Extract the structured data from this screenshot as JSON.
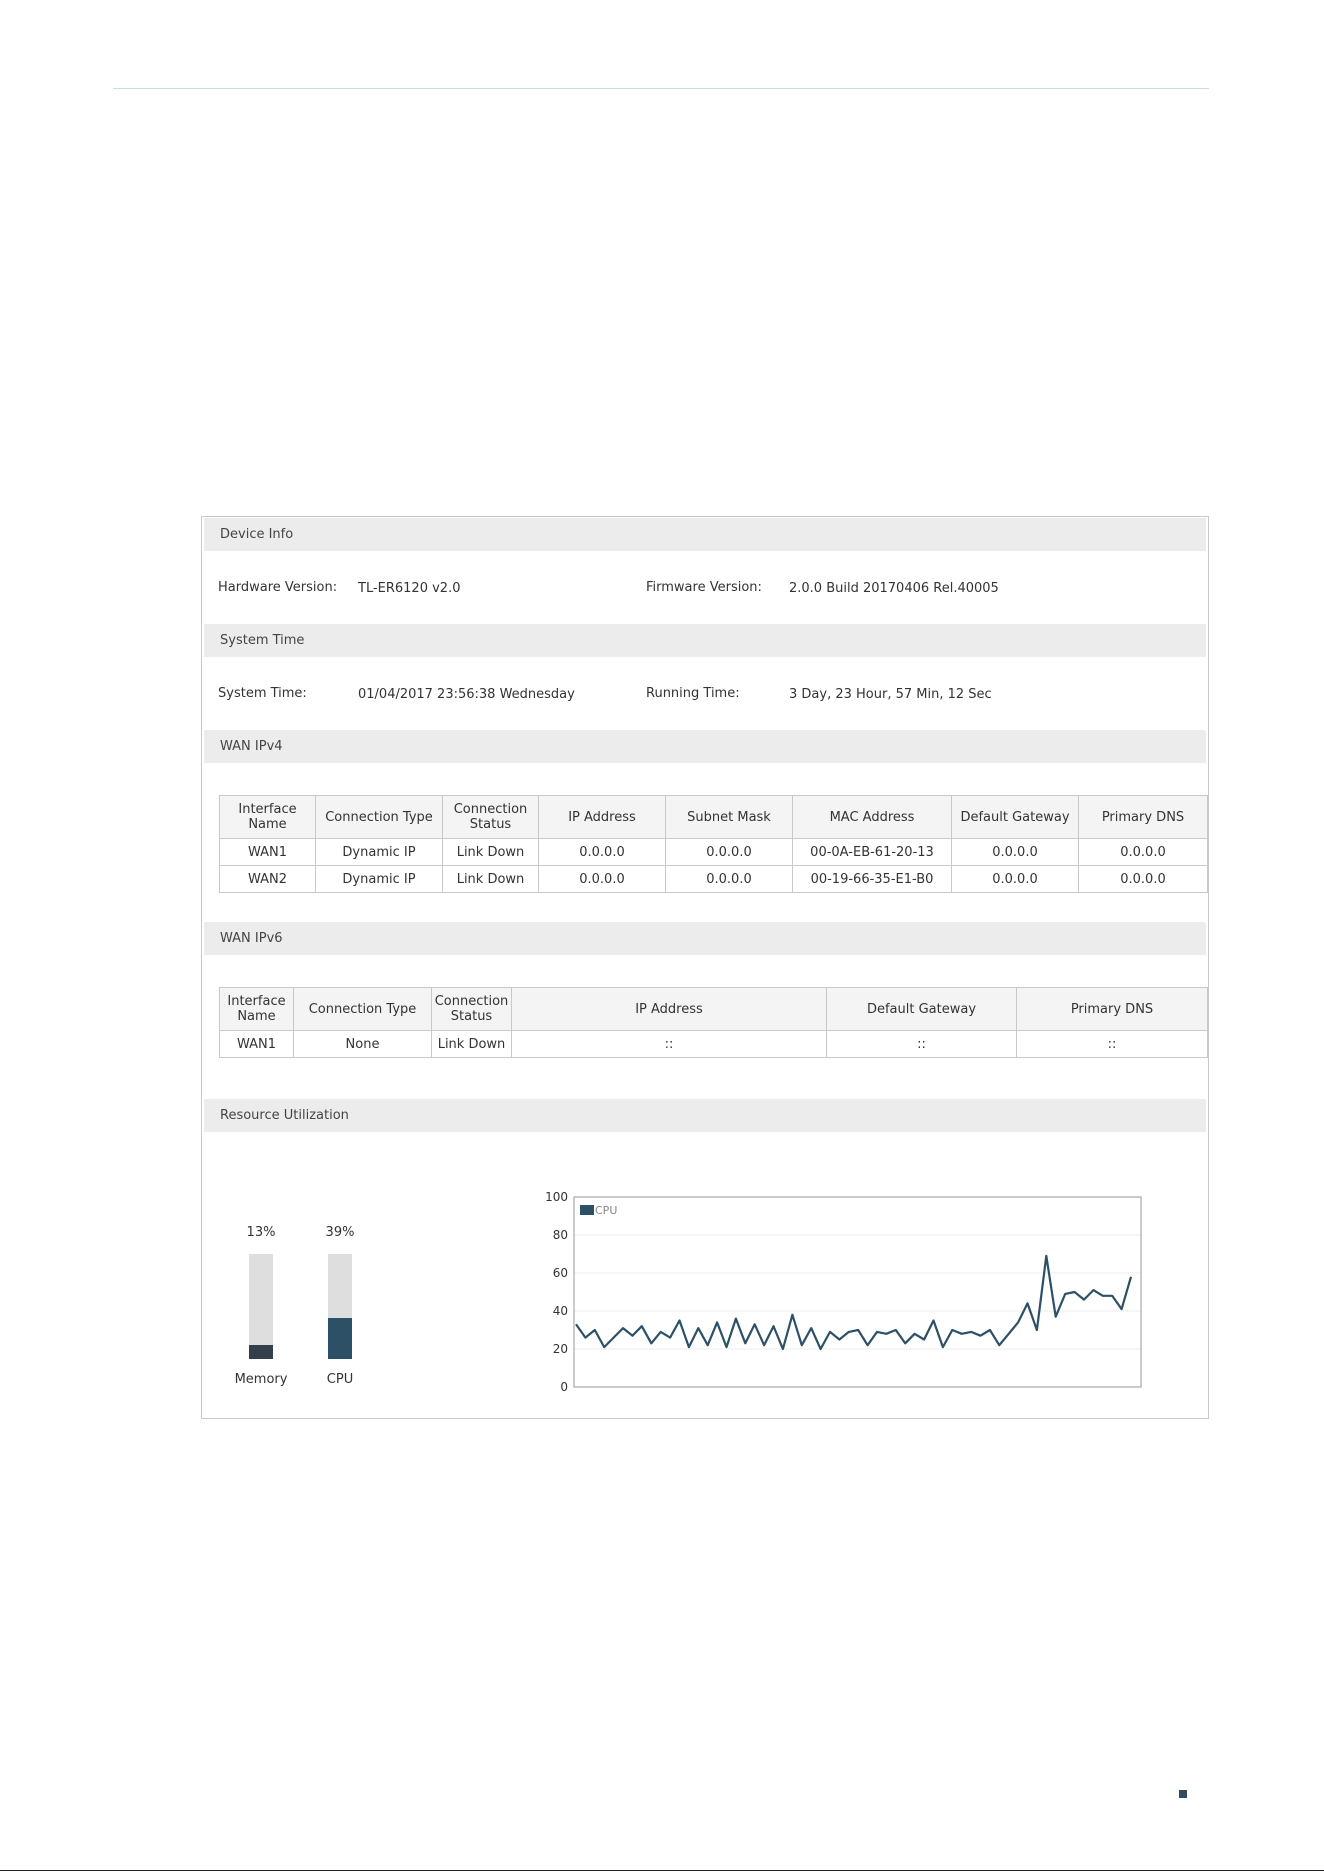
{
  "device_info": {
    "header": "Device Info",
    "hardware_label": "Hardware Version:",
    "hardware_value": "TL-ER6120 v2.0",
    "firmware_label": "Firmware Version:",
    "firmware_value": "2.0.0 Build 20170406 Rel.40005"
  },
  "system_time": {
    "header": "System Time",
    "time_label": "System Time:",
    "time_value": "01/04/2017 23:56:38 Wednesday",
    "running_label": "Running Time:",
    "running_value": "3 Day, 23 Hour, 57 Min, 12 Sec"
  },
  "wan_ipv4": {
    "header": "WAN IPv4",
    "columns": [
      "Interface Name",
      "Connection Type",
      "Connection Status",
      "IP Address",
      "Subnet Mask",
      "MAC Address",
      "Default Gateway",
      "Primary DNS"
    ],
    "rows": [
      [
        "WAN1",
        "Dynamic IP",
        "Link Down",
        "0.0.0.0",
        "0.0.0.0",
        "00-0A-EB-61-20-13",
        "0.0.0.0",
        "0.0.0.0"
      ],
      [
        "WAN2",
        "Dynamic IP",
        "Link Down",
        "0.0.0.0",
        "0.0.0.0",
        "00-19-66-35-E1-B0",
        "0.0.0.0",
        "0.0.0.0"
      ]
    ]
  },
  "wan_ipv6": {
    "header": "WAN IPv6",
    "columns": [
      "Interface Name",
      "Connection Type",
      "Connection Status",
      "IP Address",
      "Default Gateway",
      "Primary DNS"
    ],
    "rows": [
      [
        "WAN1",
        "None",
        "Link Down",
        "::",
        "::",
        "::"
      ]
    ]
  },
  "resource": {
    "header": "Resource Utilization",
    "memory": {
      "label": "Memory",
      "percent_text": "13%",
      "level": 0.13,
      "color": "#333f4b"
    },
    "cpu": {
      "label": "CPU",
      "percent_text": "39%",
      "level": 0.39,
      "color": "#2c5066"
    }
  },
  "colors": {
    "cpu_line": "#2c5066",
    "header_bg": "#ececec",
    "border": "#c9c9c9"
  },
  "chart_data": {
    "type": "line",
    "title": "",
    "xlabel": "",
    "ylabel": "",
    "ylim": [
      0,
      100
    ],
    "yticks": [
      0,
      20,
      40,
      60,
      80,
      100
    ],
    "grid": true,
    "legend": "top-left",
    "series": [
      {
        "name": "CPU",
        "color": "#2c5066",
        "values": [
          33,
          26,
          30,
          21,
          26,
          31,
          27,
          32,
          23,
          29,
          26,
          35,
          21,
          31,
          22,
          34,
          21,
          36,
          23,
          33,
          22,
          32,
          20,
          38,
          22,
          31,
          20,
          29,
          25,
          29,
          30,
          22,
          29,
          28,
          30,
          23,
          28,
          25,
          35,
          21,
          30,
          28,
          29,
          27,
          30,
          22,
          28,
          34,
          44,
          30,
          69,
          37,
          49,
          50,
          46,
          51,
          48,
          48,
          41,
          58
        ]
      }
    ]
  }
}
